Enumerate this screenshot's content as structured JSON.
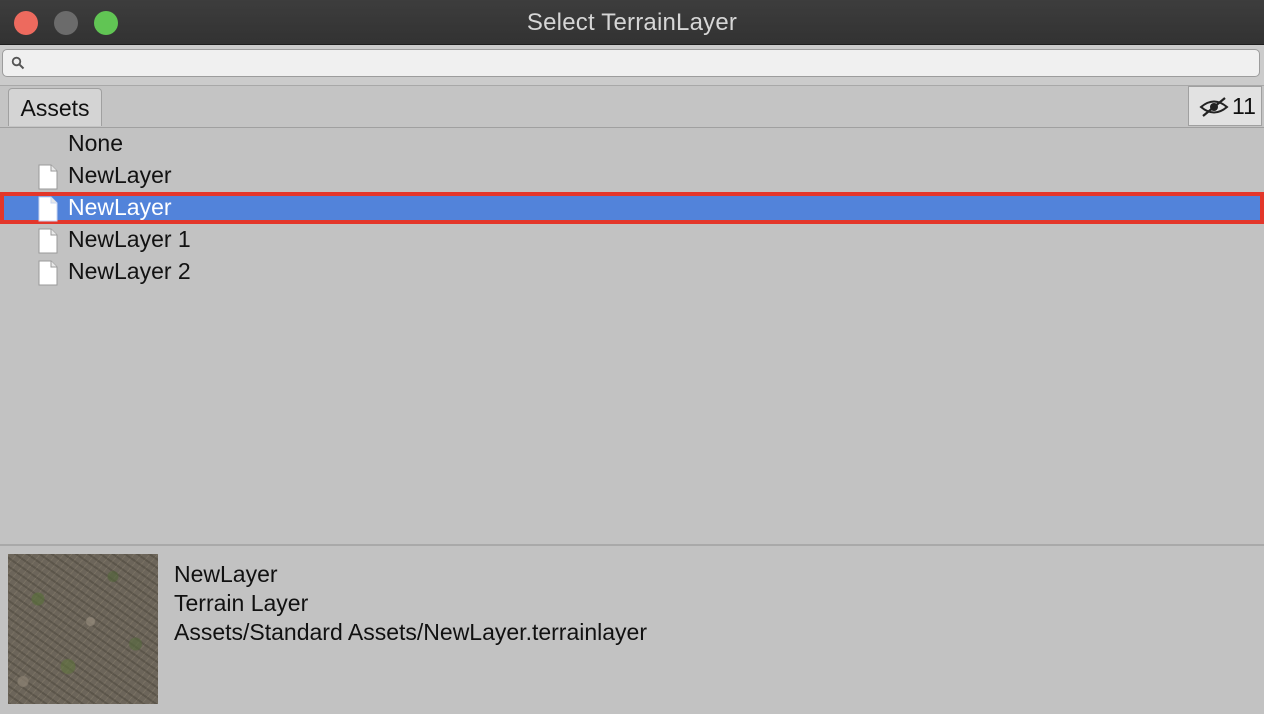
{
  "window": {
    "title": "Select TerrainLayer"
  },
  "search": {
    "value": "",
    "placeholder": ""
  },
  "tabs": [
    {
      "label": "Assets",
      "selected": true
    }
  ],
  "hidden_count": "11",
  "list": {
    "items": [
      {
        "label": "None",
        "icon": "",
        "selected": false
      },
      {
        "label": "NewLayer",
        "icon": "file-icon",
        "selected": false
      },
      {
        "label": "NewLayer",
        "icon": "file-icon",
        "selected": true
      },
      {
        "label": "NewLayer 1",
        "icon": "file-icon",
        "selected": false
      },
      {
        "label": "NewLayer 2",
        "icon": "file-icon",
        "selected": false
      }
    ]
  },
  "preview": {
    "name": "NewLayer",
    "type": "Terrain Layer",
    "path": "Assets/Standard Assets/NewLayer.terrainlayer"
  },
  "colors": {
    "selection": "#5283da",
    "selection_outline": "#e3362a",
    "titlebar": "#353535"
  }
}
